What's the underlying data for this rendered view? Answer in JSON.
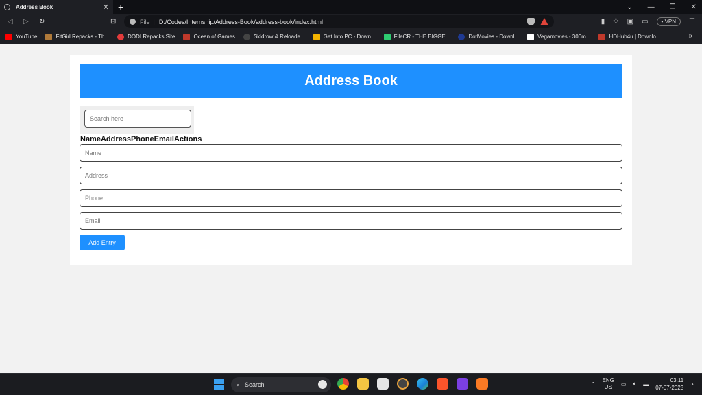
{
  "browser": {
    "tab_title": "Address Book",
    "tab_close": "✕",
    "new_tab": "+",
    "url_scheme_label": "File",
    "url": "D:/Codes/Internship/Address-Book/address-book/index.html",
    "vpn_label": "• VPN",
    "bookmarks": [
      {
        "label": "YouTube",
        "color": "#ff0000"
      },
      {
        "label": "FitGirl Repacks - Th...",
        "color": "#b07a3a"
      },
      {
        "label": "DODI Repacks Site",
        "color": "#e23b3b"
      },
      {
        "label": "Ocean of Games",
        "color": "#c0392b"
      },
      {
        "label": "Skidrow & Reloade...",
        "color": "#333333"
      },
      {
        "label": "Get Into PC - Down...",
        "color": "#f5b400"
      },
      {
        "label": "FileCR - THE BIGGE...",
        "color": "#2ecc71"
      },
      {
        "label": "DotMovies - Downl...",
        "color": "#1f3a93"
      },
      {
        "label": "Vegamovies - 300m...",
        "color": "#ffffff"
      },
      {
        "label": "HDHub4u | Downlo...",
        "color": "#c0392b"
      }
    ],
    "bookmarks_more": "»"
  },
  "page": {
    "header_title": "Address Book",
    "search_placeholder": "Search here",
    "columns": [
      "Name",
      "Address",
      "Phone",
      "Email",
      "Actions"
    ],
    "fields": {
      "name_placeholder": "Name",
      "address_placeholder": "Address",
      "phone_placeholder": "Phone",
      "email_placeholder": "Email"
    },
    "add_button_label": "Add Entry"
  },
  "taskbar": {
    "search_label": "Search",
    "language_line1": "ENG",
    "language_line2": "US",
    "time": "03:11",
    "date": "07-07-2023"
  }
}
